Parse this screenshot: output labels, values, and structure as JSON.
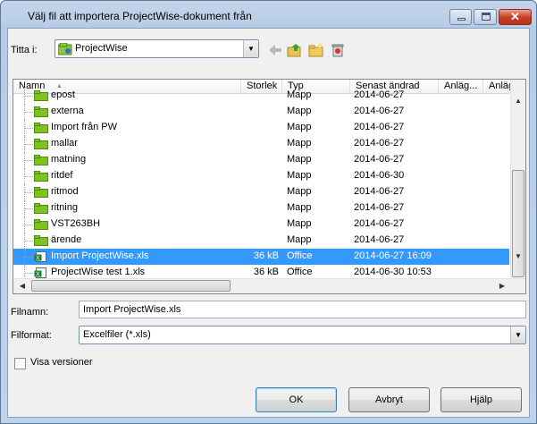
{
  "window": {
    "title": "Välj fil att importera ProjectWise-dokument från"
  },
  "lookin": {
    "label": "Titta i:",
    "value": "ProjectWise"
  },
  "toolbar": {
    "icons": [
      "back-arrow-icon",
      "up-folder-icon",
      "new-folder-icon",
      "delete-icon"
    ]
  },
  "columns": [
    "Namn",
    "Storlek",
    "Typ",
    "Senast ändrad",
    "Anläg...",
    "Anläg..."
  ],
  "rows": [
    {
      "name": "epost",
      "size": "",
      "type": "Mapp",
      "modified": "2014-06-27",
      "kind": "folder"
    },
    {
      "name": "externa",
      "size": "",
      "type": "Mapp",
      "modified": "2014-06-27",
      "kind": "folder"
    },
    {
      "name": "Import från PW",
      "size": "",
      "type": "Mapp",
      "modified": "2014-06-27",
      "kind": "folder"
    },
    {
      "name": "mallar",
      "size": "",
      "type": "Mapp",
      "modified": "2014-06-27",
      "kind": "folder"
    },
    {
      "name": "matning",
      "size": "",
      "type": "Mapp",
      "modified": "2014-06-27",
      "kind": "folder"
    },
    {
      "name": "ritdef",
      "size": "",
      "type": "Mapp",
      "modified": "2014-06-30",
      "kind": "folder"
    },
    {
      "name": "ritmod",
      "size": "",
      "type": "Mapp",
      "modified": "2014-06-27",
      "kind": "folder"
    },
    {
      "name": "ritning",
      "size": "",
      "type": "Mapp",
      "modified": "2014-06-27",
      "kind": "folder"
    },
    {
      "name": "VST263BH",
      "size": "",
      "type": "Mapp",
      "modified": "2014-06-27",
      "kind": "folder"
    },
    {
      "name": "ärende",
      "size": "",
      "type": "Mapp",
      "modified": "2014-06-27",
      "kind": "folder"
    },
    {
      "name": "Import ProjectWise.xls",
      "size": "36 kB",
      "type": "Office",
      "modified": "2014-06-27 16:09",
      "kind": "xls",
      "selected": true
    },
    {
      "name": "ProjectWise test 1.xls",
      "size": "36 kB",
      "type": "Office",
      "modified": "2014-06-30 10:53",
      "kind": "xls"
    }
  ],
  "filename": {
    "label": "Filnamn:",
    "value": "Import ProjectWise.xls"
  },
  "fileformat": {
    "label": "Filformat:",
    "value": "Excelfiler (*.xls)"
  },
  "versions": {
    "label": "Visa versioner",
    "checked": false
  },
  "buttons": {
    "ok": "OK",
    "cancel": "Avbryt",
    "help": "Hjälp"
  },
  "colors": {
    "selection": "#3399ff",
    "folder": "#7ec21f"
  }
}
